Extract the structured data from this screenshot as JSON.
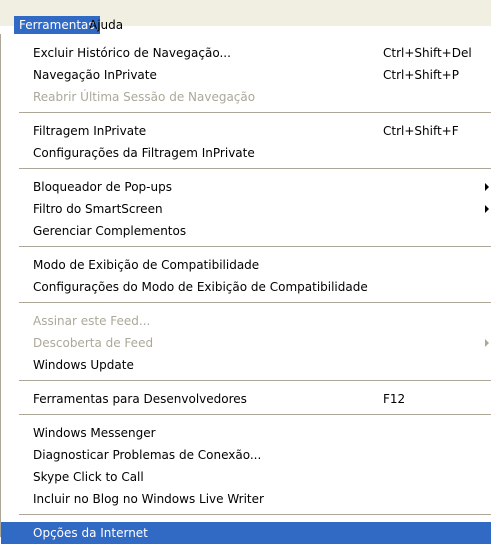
{
  "menubar": {
    "items": [
      {
        "label": "Ferramentas",
        "active": true
      },
      {
        "label": "Ajuda",
        "active": false
      }
    ]
  },
  "menu": {
    "groups": [
      [
        {
          "label": "Excluir Histórico de Navegação...",
          "shortcut": "Ctrl+Shift+Del",
          "enabled": true
        },
        {
          "label": "Navegação InPrivate",
          "shortcut": "Ctrl+Shift+P",
          "enabled": true
        },
        {
          "label": "Reabrir Última Sessão de Navegação",
          "shortcut": "",
          "enabled": false
        }
      ],
      [
        {
          "label": "Filtragem InPrivate",
          "shortcut": "Ctrl+Shift+F",
          "enabled": true
        },
        {
          "label": "Configurações da Filtragem InPrivate",
          "shortcut": "",
          "enabled": true
        }
      ],
      [
        {
          "label": "Bloqueador de Pop-ups",
          "shortcut": "",
          "enabled": true,
          "submenu": true
        },
        {
          "label": "Filtro do SmartScreen",
          "shortcut": "",
          "enabled": true,
          "submenu": true
        },
        {
          "label": "Gerenciar Complementos",
          "shortcut": "",
          "enabled": true
        }
      ],
      [
        {
          "label": "Modo de Exibição de Compatibilidade",
          "shortcut": "",
          "enabled": true
        },
        {
          "label": "Configurações do Modo de Exibição de Compatibilidade",
          "shortcut": "",
          "enabled": true
        }
      ],
      [
        {
          "label": "Assinar este Feed...",
          "shortcut": "",
          "enabled": false
        },
        {
          "label": "Descoberta de Feed",
          "shortcut": "",
          "enabled": false,
          "submenu": true
        },
        {
          "label": "Windows Update",
          "shortcut": "",
          "enabled": true
        }
      ],
      [
        {
          "label": "Ferramentas para Desenvolvedores",
          "shortcut": "F12",
          "enabled": true
        }
      ],
      [
        {
          "label": "Windows Messenger",
          "shortcut": "",
          "enabled": true
        },
        {
          "label": "Diagnosticar Problemas de Conexão...",
          "shortcut": "",
          "enabled": true
        },
        {
          "label": "Skype Click to Call",
          "shortcut": "",
          "enabled": true
        },
        {
          "label": "Incluir no Blog no Windows Live Writer",
          "shortcut": "",
          "enabled": true
        }
      ],
      [
        {
          "label": "Opções da Internet",
          "shortcut": "",
          "enabled": true,
          "highlighted": true
        }
      ]
    ]
  },
  "colors": {
    "highlight": "#316ac5",
    "disabled_text": "#aca899",
    "menubar_bg": "#f1efe2"
  }
}
